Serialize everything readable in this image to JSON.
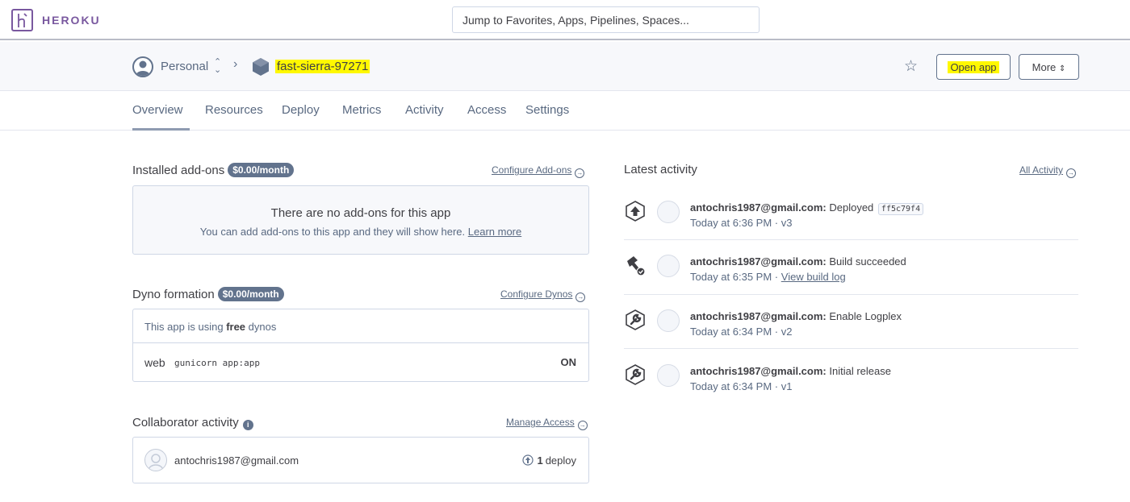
{
  "topbar": {
    "brand": "HEROKU",
    "search_placeholder": "Jump to Favorites, Apps, Pipelines, Spaces..."
  },
  "header": {
    "space": "Personal",
    "app_name": "fast-sierra-97271",
    "open_app_label": "Open app",
    "more_label": "More"
  },
  "tabs": [
    "Overview",
    "Resources",
    "Deploy",
    "Metrics",
    "Activity",
    "Access",
    "Settings"
  ],
  "addons": {
    "title": "Installed add-ons",
    "price": "$0.00/month",
    "configure_link": "Configure Add-ons",
    "empty_title": "There are no add-ons for this app",
    "empty_sub": "You can add add-ons to this app and they will show here.",
    "learn_more": "Learn more"
  },
  "dynos": {
    "title": "Dyno formation",
    "price": "$0.00/month",
    "configure_link": "Configure Dynos",
    "usage_prefix": "This app is using",
    "usage_type": "free",
    "usage_suffix": "dynos",
    "process": "web",
    "command": "gunicorn app:app",
    "state": "ON"
  },
  "collaborators": {
    "title": "Collaborator activity",
    "manage_link": "Manage Access",
    "email": "antochris1987@gmail.com",
    "deploy_count": "1",
    "deploy_label": "deploy"
  },
  "activity": {
    "title": "Latest activity",
    "all_link": "All Activity",
    "items": [
      {
        "user": "antochris1987@gmail.com:",
        "action": "Deployed",
        "commit": "ff5c79f4",
        "time": "Today at 6:36 PM",
        "meta": "· v3",
        "link": "",
        "icon": "deploy-icon"
      },
      {
        "user": "antochris1987@gmail.com:",
        "action": "Build succeeded",
        "commit": "",
        "time": "Today at 6:35 PM",
        "meta": "·",
        "link": "View build log",
        "icon": "build-icon"
      },
      {
        "user": "antochris1987@gmail.com:",
        "action": "Enable Logplex",
        "commit": "",
        "time": "Today at 6:34 PM",
        "meta": "· v2",
        "link": "",
        "icon": "release-icon"
      },
      {
        "user": "antochris1987@gmail.com:",
        "action": "Initial release",
        "commit": "",
        "time": "Today at 6:34 PM",
        "meta": "· v1",
        "link": "",
        "icon": "release-icon"
      }
    ]
  },
  "colors": {
    "brand": "#79589f",
    "highlight": "#fff800",
    "text": "#3f3f44",
    "muted": "#596981"
  }
}
